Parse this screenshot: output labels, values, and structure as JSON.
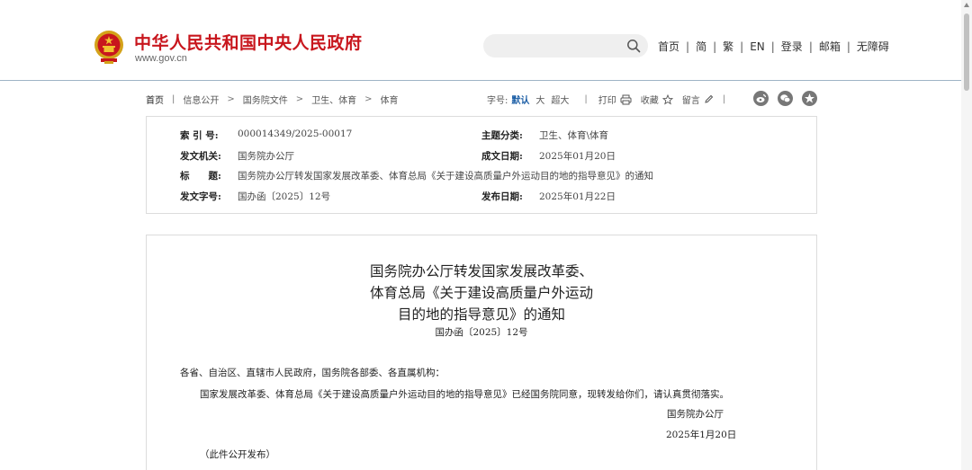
{
  "header": {
    "site_title": "中华人民共和国中央人民政府",
    "site_url": "www.gov.cn",
    "search_placeholder": "",
    "nav": [
      "首页",
      "简",
      "繁",
      "EN",
      "登录",
      "邮箱",
      "无障碍"
    ]
  },
  "breadcrumb": {
    "items": [
      "首页",
      "信息公开",
      "国务院文件",
      "卫生、体育",
      "体育"
    ]
  },
  "tools": {
    "font_size_label": "字号:",
    "font_sizes": [
      "默认",
      "大",
      "超大"
    ],
    "print_label": "打印",
    "favorite_label": "收藏",
    "comment_label": "留言",
    "share_icons": [
      "weibo-icon",
      "wechat-icon",
      "qzone-icon"
    ]
  },
  "info": {
    "index_no_label": "索 引 号:",
    "index_no": "000014349/2025-00017",
    "topic_label": "主题分类:",
    "topic": "卫生、体育\\体育",
    "issuer_label": "发文机关:",
    "issuer": "国务院办公厅",
    "written_date_label": "成文日期:",
    "written_date": "2025年01月20日",
    "title_label": "标　　题:",
    "title": "国务院办公厅转发国家发展改革委、体育总局《关于建设高质量户外运动目的地的指导意见》的通知",
    "doc_no_label": "发文字号:",
    "doc_no": "国办函〔2025〕12号",
    "publish_date_label": "发布日期:",
    "publish_date": "2025年01月22日"
  },
  "document": {
    "title_line1": "国务院办公厅转发国家发展改革委、",
    "title_line2": "体育总局《关于建设高质量户外运动",
    "title_line3": "目的地的指导意见》的通知",
    "doc_no": "国办函〔2025〕12号",
    "salutation": "各省、自治区、直辖市人民政府，国务院各部委、各直属机构：",
    "body": "国家发展改革委、体育总局《关于建设高质量户外运动目的地的指导意见》已经国务院同意，现转发给你们，请认真贯彻落实。",
    "signatory": "国务院办公厅",
    "sign_date": "2025年1月20日",
    "note": "（此件公开发布）"
  },
  "colors": {
    "brand_red": "#c8161d",
    "accent_blue": "#1d5fa6",
    "border": "#dcdcdc",
    "header_line": "#9fb4c6"
  }
}
